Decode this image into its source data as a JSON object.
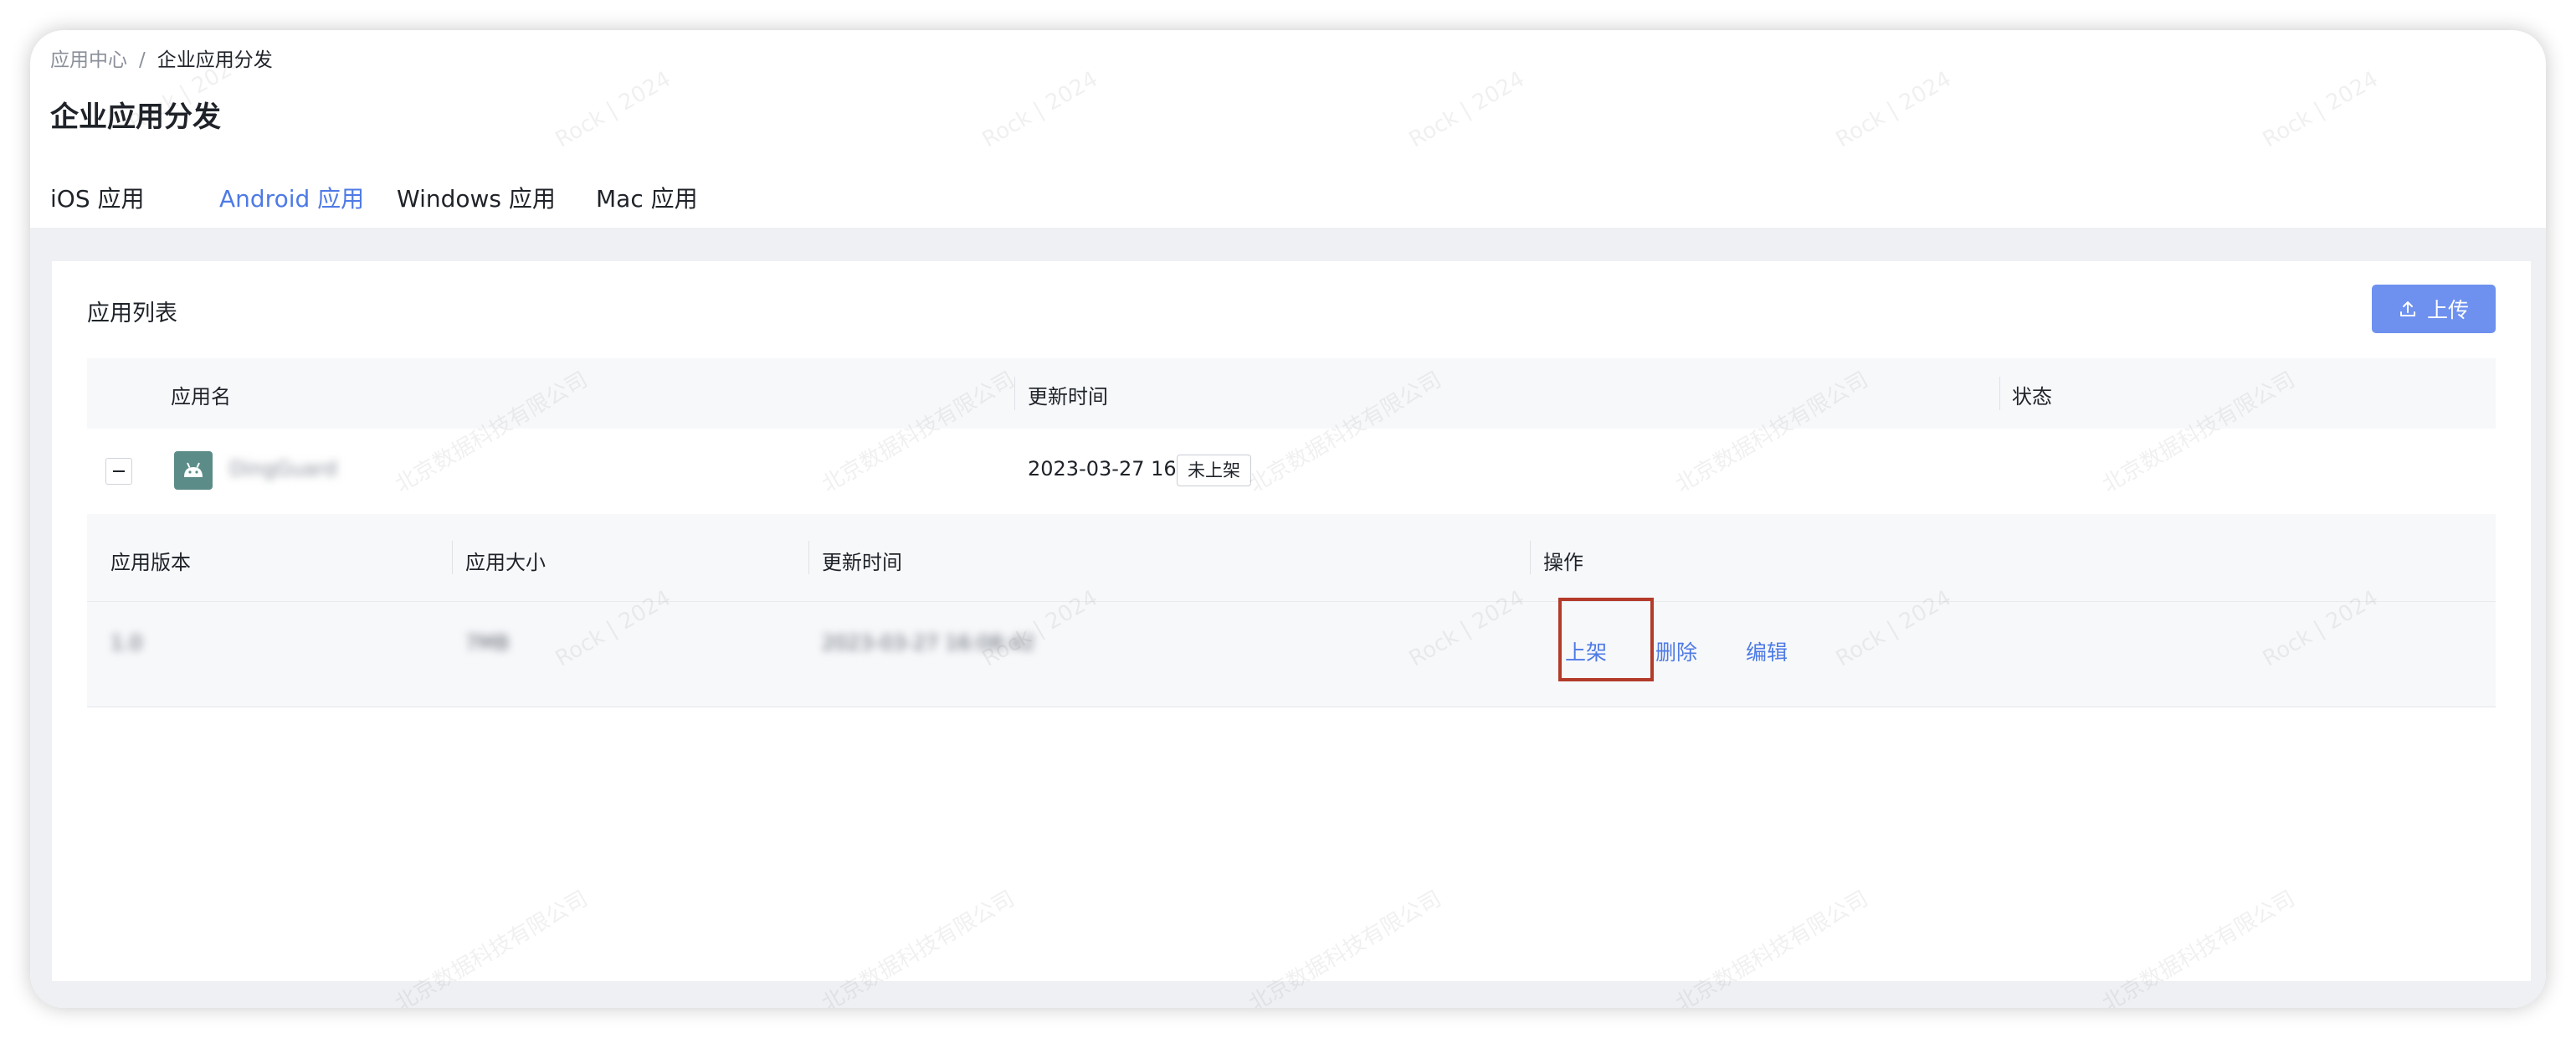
{
  "breadcrumb": {
    "root": "应用中心",
    "separator": "/",
    "current": "企业应用分发"
  },
  "page_title": "企业应用分发",
  "tabs": [
    {
      "label": "iOS 应用",
      "active": false
    },
    {
      "label": "Android 应用",
      "active": true
    },
    {
      "label": "Windows 应用",
      "active": false
    },
    {
      "label": "Mac 应用",
      "active": false
    }
  ],
  "card": {
    "title": "应用列表",
    "upload_label": "上传",
    "upload_icon": "upload-icon",
    "columns": {
      "name": "应用名",
      "updated": "更新时间",
      "status": "状态"
    },
    "apps": [
      {
        "icon": "android-icon",
        "name": "DingGuard",
        "updated": "2023-03-27 16:08:42",
        "status": "未上架",
        "expanded": true,
        "versions": {
          "columns": {
            "version": "应用版本",
            "size": "应用大小",
            "updated": "更新时间",
            "actions": "操作"
          },
          "rows": [
            {
              "version": "1.0",
              "size": "7MB",
              "updated": "2023-03-27 16:08:42",
              "actions": {
                "publish": "上架",
                "delete": "删除",
                "edit": "编辑"
              }
            }
          ]
        }
      }
    ]
  },
  "watermarks": {
    "top": "Rock | 2024",
    "company": "北京数据科技有限公司"
  },
  "colors": {
    "accent": "#4e7ae6",
    "button": "#6e91ef",
    "highlight": "#b43a2a",
    "app_icon_bg": "#5b8c88"
  }
}
